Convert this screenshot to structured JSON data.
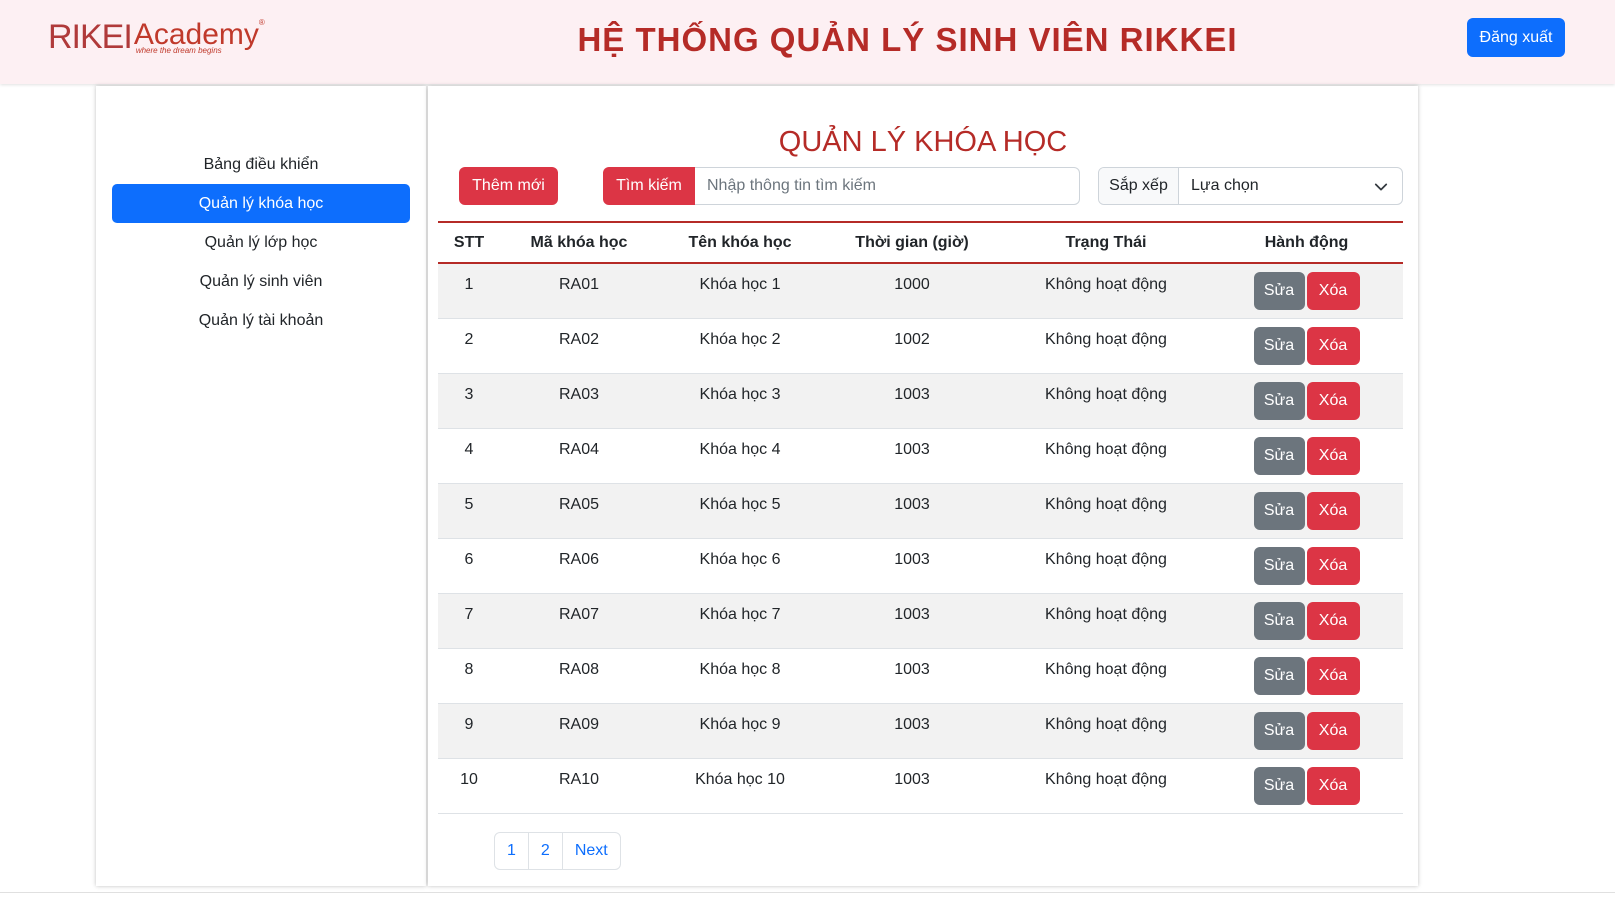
{
  "header": {
    "logo_rikei": "RIKEI",
    "logo_academy": "Academy",
    "logo_reg": "®",
    "logo_tagline": "where the dream begins",
    "title": "HỆ THỐNG QUẢN LÝ SINH VIÊN RIKKEI",
    "logout_label": "Đăng xuất"
  },
  "sidebar": {
    "items": [
      {
        "label": "Bảng điều khiển",
        "active": false
      },
      {
        "label": "Quản lý khóa học",
        "active": true
      },
      {
        "label": "Quản lý lớp học",
        "active": false
      },
      {
        "label": "Quản lý sinh viên",
        "active": false
      },
      {
        "label": "Quản lý tài khoản",
        "active": false
      }
    ]
  },
  "main": {
    "title": "QUẢN LÝ KHÓA HỌC",
    "add_label": "Thêm mới",
    "search_label": "Tìm kiếm",
    "search_placeholder": "Nhập thông tin tìm kiếm",
    "sort_label": "Sắp xếp",
    "sort_selected": "Lựa chọn"
  },
  "table": {
    "headers": [
      "STT",
      "Mã khóa học",
      "Tên khóa học",
      "Thời gian (giờ)",
      "Trạng Thái",
      "Hành động"
    ],
    "edit_label": "Sửa",
    "delete_label": "Xóa",
    "rows": [
      [
        "1",
        "RA01",
        "Khóa học 1",
        "1000",
        "Không hoạt động"
      ],
      [
        "2",
        "RA02",
        "Khóa học 2",
        "1002",
        "Không hoạt động"
      ],
      [
        "3",
        "RA03",
        "Khóa học 3",
        "1003",
        "Không hoạt động"
      ],
      [
        "4",
        "RA04",
        "Khóa học 4",
        "1003",
        "Không hoạt động"
      ],
      [
        "5",
        "RA05",
        "Khóa học 5",
        "1003",
        "Không hoạt động"
      ],
      [
        "6",
        "RA06",
        "Khóa học 6",
        "1003",
        "Không hoạt động"
      ],
      [
        "7",
        "RA07",
        "Khóa học 7",
        "1003",
        "Không hoạt động"
      ],
      [
        "8",
        "RA08",
        "Khóa học 8",
        "1003",
        "Không hoạt động"
      ],
      [
        "9",
        "RA09",
        "Khóa học 9",
        "1003",
        "Không hoạt động"
      ],
      [
        "10",
        "RA10",
        "Khóa học 10",
        "1003",
        "Không hoạt động"
      ]
    ]
  },
  "pagination": {
    "pages": [
      "1",
      "2"
    ],
    "next_label": "Next"
  },
  "colors": {
    "brand_red": "#b52b27",
    "danger": "#dc3545",
    "primary": "#0d6efd",
    "secondary": "#6c757d",
    "header_bg": "#fdf0f3"
  },
  "icons": {
    "sort_dropdown": "chevron-down-icon"
  }
}
